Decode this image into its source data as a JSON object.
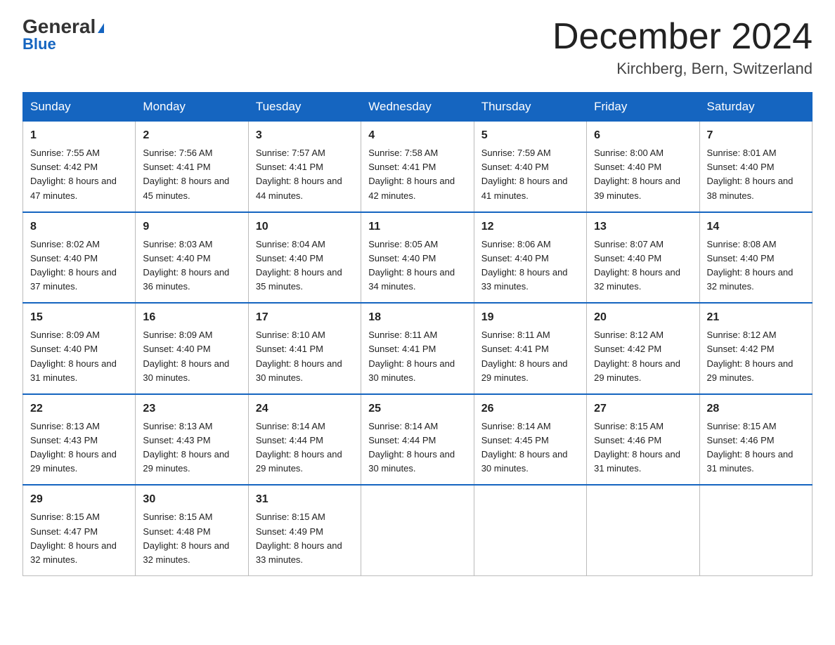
{
  "header": {
    "logo_general": "General",
    "logo_blue": "Blue",
    "title": "December 2024",
    "location": "Kirchberg, Bern, Switzerland"
  },
  "columns": [
    "Sunday",
    "Monday",
    "Tuesday",
    "Wednesday",
    "Thursday",
    "Friday",
    "Saturday"
  ],
  "weeks": [
    [
      {
        "day": "1",
        "sunrise": "7:55 AM",
        "sunset": "4:42 PM",
        "daylight": "8 hours and 47 minutes."
      },
      {
        "day": "2",
        "sunrise": "7:56 AM",
        "sunset": "4:41 PM",
        "daylight": "8 hours and 45 minutes."
      },
      {
        "day": "3",
        "sunrise": "7:57 AM",
        "sunset": "4:41 PM",
        "daylight": "8 hours and 44 minutes."
      },
      {
        "day": "4",
        "sunrise": "7:58 AM",
        "sunset": "4:41 PM",
        "daylight": "8 hours and 42 minutes."
      },
      {
        "day": "5",
        "sunrise": "7:59 AM",
        "sunset": "4:40 PM",
        "daylight": "8 hours and 41 minutes."
      },
      {
        "day": "6",
        "sunrise": "8:00 AM",
        "sunset": "4:40 PM",
        "daylight": "8 hours and 39 minutes."
      },
      {
        "day": "7",
        "sunrise": "8:01 AM",
        "sunset": "4:40 PM",
        "daylight": "8 hours and 38 minutes."
      }
    ],
    [
      {
        "day": "8",
        "sunrise": "8:02 AM",
        "sunset": "4:40 PM",
        "daylight": "8 hours and 37 minutes."
      },
      {
        "day": "9",
        "sunrise": "8:03 AM",
        "sunset": "4:40 PM",
        "daylight": "8 hours and 36 minutes."
      },
      {
        "day": "10",
        "sunrise": "8:04 AM",
        "sunset": "4:40 PM",
        "daylight": "8 hours and 35 minutes."
      },
      {
        "day": "11",
        "sunrise": "8:05 AM",
        "sunset": "4:40 PM",
        "daylight": "8 hours and 34 minutes."
      },
      {
        "day": "12",
        "sunrise": "8:06 AM",
        "sunset": "4:40 PM",
        "daylight": "8 hours and 33 minutes."
      },
      {
        "day": "13",
        "sunrise": "8:07 AM",
        "sunset": "4:40 PM",
        "daylight": "8 hours and 32 minutes."
      },
      {
        "day": "14",
        "sunrise": "8:08 AM",
        "sunset": "4:40 PM",
        "daylight": "8 hours and 32 minutes."
      }
    ],
    [
      {
        "day": "15",
        "sunrise": "8:09 AM",
        "sunset": "4:40 PM",
        "daylight": "8 hours and 31 minutes."
      },
      {
        "day": "16",
        "sunrise": "8:09 AM",
        "sunset": "4:40 PM",
        "daylight": "8 hours and 30 minutes."
      },
      {
        "day": "17",
        "sunrise": "8:10 AM",
        "sunset": "4:41 PM",
        "daylight": "8 hours and 30 minutes."
      },
      {
        "day": "18",
        "sunrise": "8:11 AM",
        "sunset": "4:41 PM",
        "daylight": "8 hours and 30 minutes."
      },
      {
        "day": "19",
        "sunrise": "8:11 AM",
        "sunset": "4:41 PM",
        "daylight": "8 hours and 29 minutes."
      },
      {
        "day": "20",
        "sunrise": "8:12 AM",
        "sunset": "4:42 PM",
        "daylight": "8 hours and 29 minutes."
      },
      {
        "day": "21",
        "sunrise": "8:12 AM",
        "sunset": "4:42 PM",
        "daylight": "8 hours and 29 minutes."
      }
    ],
    [
      {
        "day": "22",
        "sunrise": "8:13 AM",
        "sunset": "4:43 PM",
        "daylight": "8 hours and 29 minutes."
      },
      {
        "day": "23",
        "sunrise": "8:13 AM",
        "sunset": "4:43 PM",
        "daylight": "8 hours and 29 minutes."
      },
      {
        "day": "24",
        "sunrise": "8:14 AM",
        "sunset": "4:44 PM",
        "daylight": "8 hours and 29 minutes."
      },
      {
        "day": "25",
        "sunrise": "8:14 AM",
        "sunset": "4:44 PM",
        "daylight": "8 hours and 30 minutes."
      },
      {
        "day": "26",
        "sunrise": "8:14 AM",
        "sunset": "4:45 PM",
        "daylight": "8 hours and 30 minutes."
      },
      {
        "day": "27",
        "sunrise": "8:15 AM",
        "sunset": "4:46 PM",
        "daylight": "8 hours and 31 minutes."
      },
      {
        "day": "28",
        "sunrise": "8:15 AM",
        "sunset": "4:46 PM",
        "daylight": "8 hours and 31 minutes."
      }
    ],
    [
      {
        "day": "29",
        "sunrise": "8:15 AM",
        "sunset": "4:47 PM",
        "daylight": "8 hours and 32 minutes."
      },
      {
        "day": "30",
        "sunrise": "8:15 AM",
        "sunset": "4:48 PM",
        "daylight": "8 hours and 32 minutes."
      },
      {
        "day": "31",
        "sunrise": "8:15 AM",
        "sunset": "4:49 PM",
        "daylight": "8 hours and 33 minutes."
      },
      null,
      null,
      null,
      null
    ]
  ]
}
